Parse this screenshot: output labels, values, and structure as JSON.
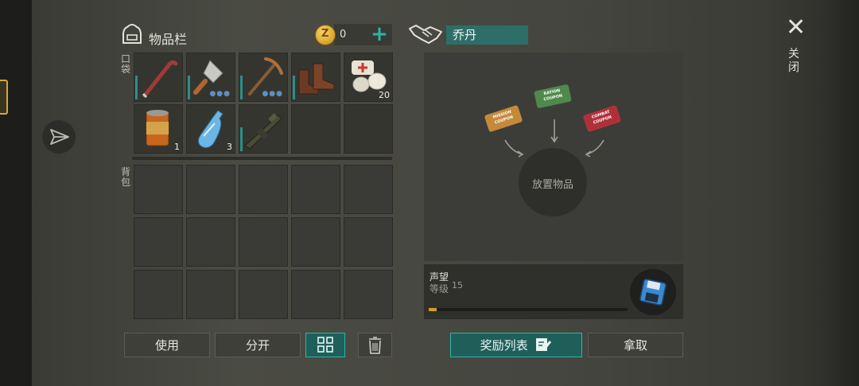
{
  "inventory": {
    "title": "物品栏",
    "coin_symbol": "Z",
    "coins": "0",
    "add_symbol": "+",
    "pocket_label": "口袋",
    "backpack_label": "背包",
    "pocket_items": [
      {
        "name": "crowbar",
        "qty": "",
        "durability_bar": true,
        "dots": false
      },
      {
        "name": "cleaver",
        "qty": "",
        "durability_bar": true,
        "dots": true
      },
      {
        "name": "pickaxe",
        "qty": "",
        "durability_bar": true,
        "dots": true
      },
      {
        "name": "boots",
        "qty": "",
        "durability_bar": true,
        "dots": false
      },
      {
        "name": "bandage",
        "qty": "20",
        "durability_bar": false,
        "dots": false
      },
      {
        "name": "canned-food",
        "qty": "1",
        "durability_bar": false,
        "dots": false
      },
      {
        "name": "water-bottle",
        "qty": "3",
        "durability_bar": false,
        "dots": false
      },
      {
        "name": "rifle",
        "qty": "",
        "durability_bar": true,
        "dots": false
      },
      {
        "name": "",
        "qty": ""
      },
      {
        "name": "",
        "qty": ""
      }
    ],
    "dots_glyph": "●●●"
  },
  "buttons": {
    "use": "使用",
    "split": "分开",
    "sort_icon": "grid-icon",
    "delete_icon": "trash-icon",
    "rewards": "奖励列表",
    "take": "拿取"
  },
  "trade": {
    "trader_name": "乔丹",
    "drop_text": "放置物品",
    "coupons": [
      {
        "text": "MISSION\nCOUPON",
        "color": "#c48a3a"
      },
      {
        "text": "RATION\nCOUPON",
        "color": "#4f8a4c"
      },
      {
        "text": "COMBAT\nCOUPON",
        "color": "#b0303a"
      }
    ]
  },
  "reputation": {
    "title": "声望",
    "level_label": "等级",
    "level": "15",
    "progress": 0.04
  },
  "close": {
    "icon": "✕",
    "label": "关闭"
  },
  "colors": {
    "accent": "#2bb6a8",
    "progress": "#d39a2a"
  }
}
